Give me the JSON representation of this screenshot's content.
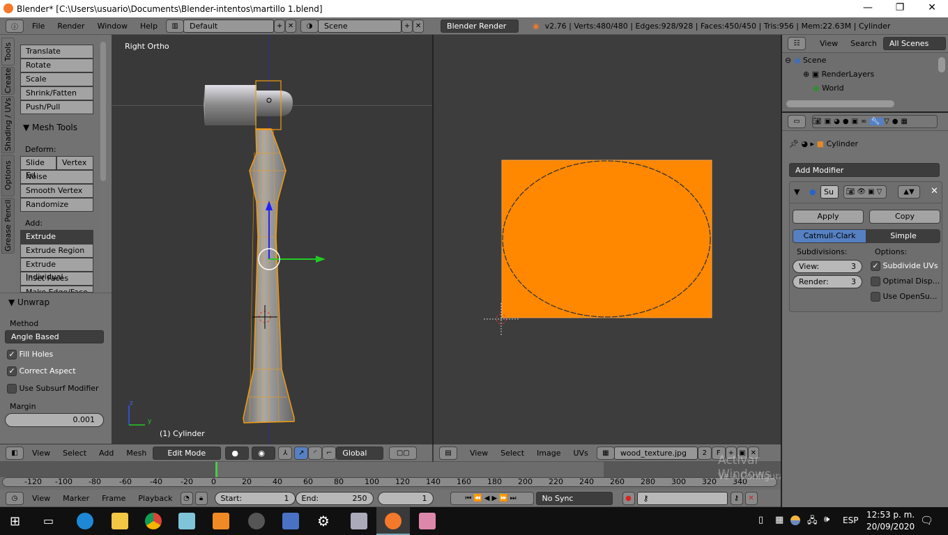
{
  "window": {
    "title": "Blender* [C:\\Users\\usuario\\Documents\\Blender-intentos\\martillo 1.blend]",
    "minimize": "—",
    "maximize": "❐",
    "close": "✕"
  },
  "info_header": {
    "menus": [
      "File",
      "Render",
      "Window",
      "Help"
    ],
    "layout": "Default",
    "scene": "Scene",
    "engine": "Blender Render",
    "stats": "v2.76 | Verts:480/480 | Edges:928/928 | Faces:450/450 | Tris:956 | Mem:22.63M | Cylinder"
  },
  "toolshelf": {
    "tabs": [
      "Tools",
      "Create",
      "Shading / UVs",
      "Options",
      "Grease Pencil"
    ],
    "transform": [
      "Translate",
      "Rotate",
      "Scale",
      "Shrink/Fatten",
      "Push/Pull"
    ],
    "mesh_tools_title": "Mesh Tools",
    "deform_label": "Deform:",
    "deform": [
      "Slide Ed",
      "Vertex",
      "Noise",
      "Smooth Vertex",
      "Randomize"
    ],
    "add_label": "Add:",
    "add": [
      "Extrude",
      "Extrude Region",
      "Extrude Individual",
      "Inset Faces",
      "Make Edge/Face"
    ]
  },
  "unwrap": {
    "title": "Unwrap",
    "method_label": "Method",
    "method": "Angle Based",
    "fill_holes": "Fill Holes",
    "fill_holes_checked": true,
    "correct_aspect": "Correct Aspect",
    "correct_aspect_checked": true,
    "use_subsurf": "Use Subsurf Modifier",
    "use_subsurf_checked": false,
    "margin_label": "Margin",
    "margin": "0.001"
  },
  "viewport3d": {
    "view_label": "Right Ortho",
    "object_label": "(1) Cylinder",
    "axis_z": "z",
    "axis_y": "y",
    "header": {
      "menus": [
        "View",
        "Select",
        "Add",
        "Mesh"
      ],
      "mode": "Edit Mode",
      "orientation": "Global"
    }
  },
  "uv_editor": {
    "header": {
      "menus": [
        "View",
        "Select",
        "Image",
        "UVs"
      ],
      "image": "wood_texture.jpg",
      "users": "2",
      "fake": "F"
    },
    "fill": "#ff8800"
  },
  "watermark": {
    "line1": "Activar Windows",
    "line2": "Ve a Configuración para activar Windows."
  },
  "outliner": {
    "menus": [
      "View",
      "Search"
    ],
    "filter": "All Scenes",
    "items": [
      "Scene",
      "RenderLayers",
      "World"
    ]
  },
  "properties": {
    "breadcrumb_object": "Cylinder",
    "add_modifier": "Add Modifier",
    "modifier_name": "Su",
    "apply": "Apply",
    "copy": "Copy",
    "types": [
      "Catmull-Clark",
      "Simple"
    ],
    "active_type": "Catmull-Clark",
    "subdivisions_label": "Subdivisions:",
    "view_label": "View:",
    "view_value": "3",
    "render_label": "Render:",
    "render_value": "3",
    "options_label": "Options:",
    "options": [
      {
        "label": "Subdivide UVs",
        "checked": true
      },
      {
        "label": "Optimal Disp...",
        "checked": false
      },
      {
        "label": "Use OpenSu...",
        "checked": false
      }
    ],
    "accent": "#5680c2"
  },
  "timeline": {
    "ticks": [
      "-120",
      "-100",
      "-80",
      "-60",
      "-40",
      "-20",
      "0",
      "20",
      "40",
      "60",
      "80",
      "100",
      "120",
      "140",
      "160",
      "180",
      "200",
      "220",
      "240",
      "260",
      "280",
      "300",
      "320",
      "340"
    ],
    "current_frame": "1",
    "start_label": "Start:",
    "start": "1",
    "end_label": "End:",
    "end": "250",
    "sync": "No Sync",
    "menus": [
      "View",
      "Marker",
      "Frame",
      "Playback"
    ]
  },
  "taskbar": {
    "lang": "ESP",
    "time": "12:53 p. m.",
    "date": "20/09/2020"
  }
}
